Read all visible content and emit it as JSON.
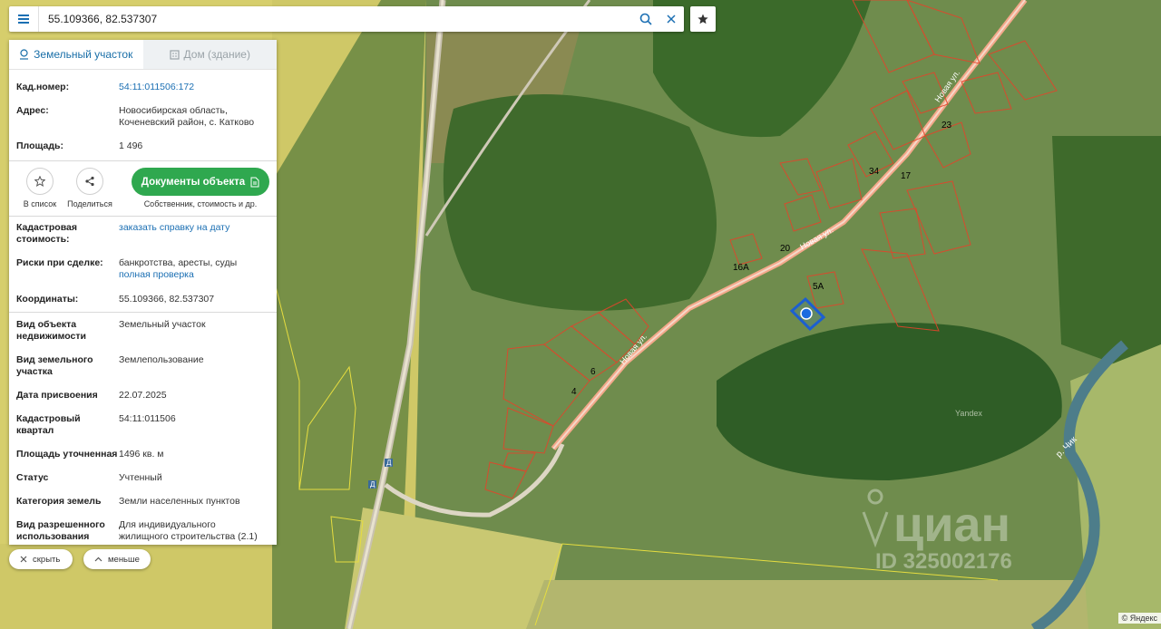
{
  "search": {
    "value": "55.109366, 82.537307"
  },
  "tabs": [
    {
      "label": "Земельный участок",
      "active": true
    },
    {
      "label": "Дом (здание)",
      "active": false
    }
  ],
  "summary": {
    "cad_label": "Кад.номер:",
    "cad_value": "54:11:011506:172",
    "addr_label": "Адрес:",
    "addr_line1": "Новосибирская область,",
    "addr_line2": "Коченевский район, с. Катково",
    "area_label": "Площадь:",
    "area_value": "1 496"
  },
  "actions": {
    "to_list": "В список",
    "share": "Поделиться",
    "docs": "Документы объекта",
    "docs_sub": "Собственник, стоимость и др."
  },
  "details": {
    "cost_label_1": "Кадастровая",
    "cost_label_2": "стоимость:",
    "cost_link": "заказать справку на дату",
    "risk_label": "Риски при сделке:",
    "risk_value": "банкротства, аресты, суды",
    "risk_link": "полная проверка",
    "coord_label": "Координаты:",
    "coord_value": "55.109366, 82.537307"
  },
  "props": {
    "type_label_1": "Вид объекта",
    "type_label_2": "недвижимости",
    "type_value": "Земельный участок",
    "kind_label_1": "Вид земельного",
    "kind_label_2": "участка",
    "kind_value": "Землепользование",
    "date_label": "Дата присвоения",
    "date_value": "22.07.2025",
    "quarter_label_1": "Кадастровый",
    "quarter_label_2": "квартал",
    "quarter_value": "54:11:011506",
    "area_label": "Площадь уточненная",
    "area_value": "1496 кв. м",
    "status_label": "Статус",
    "status_value": "Учтенный",
    "cat_label": "Категория земель",
    "cat_value": "Земли населенных пунктов",
    "use_label_1": "Вид разрешенного",
    "use_label_2": "использования",
    "use_value_1": "Для индивидуального",
    "use_value_2": "жилищного строительства (2.1)"
  },
  "buttons": {
    "hide": "скрыть",
    "less": "меньше"
  },
  "map": {
    "street": "Новая ул.",
    "labels": [
      "23",
      "34",
      "17",
      "20",
      "16А",
      "5А",
      "6",
      "4"
    ],
    "road_badge_1": "Д",
    "road_badge_2": "Д",
    "river": "р. Чик",
    "yandex_mark": "Yandex",
    "watermark_1": "циан",
    "watermark_2": "ID 325002176",
    "copyright": "© Яндекс"
  }
}
